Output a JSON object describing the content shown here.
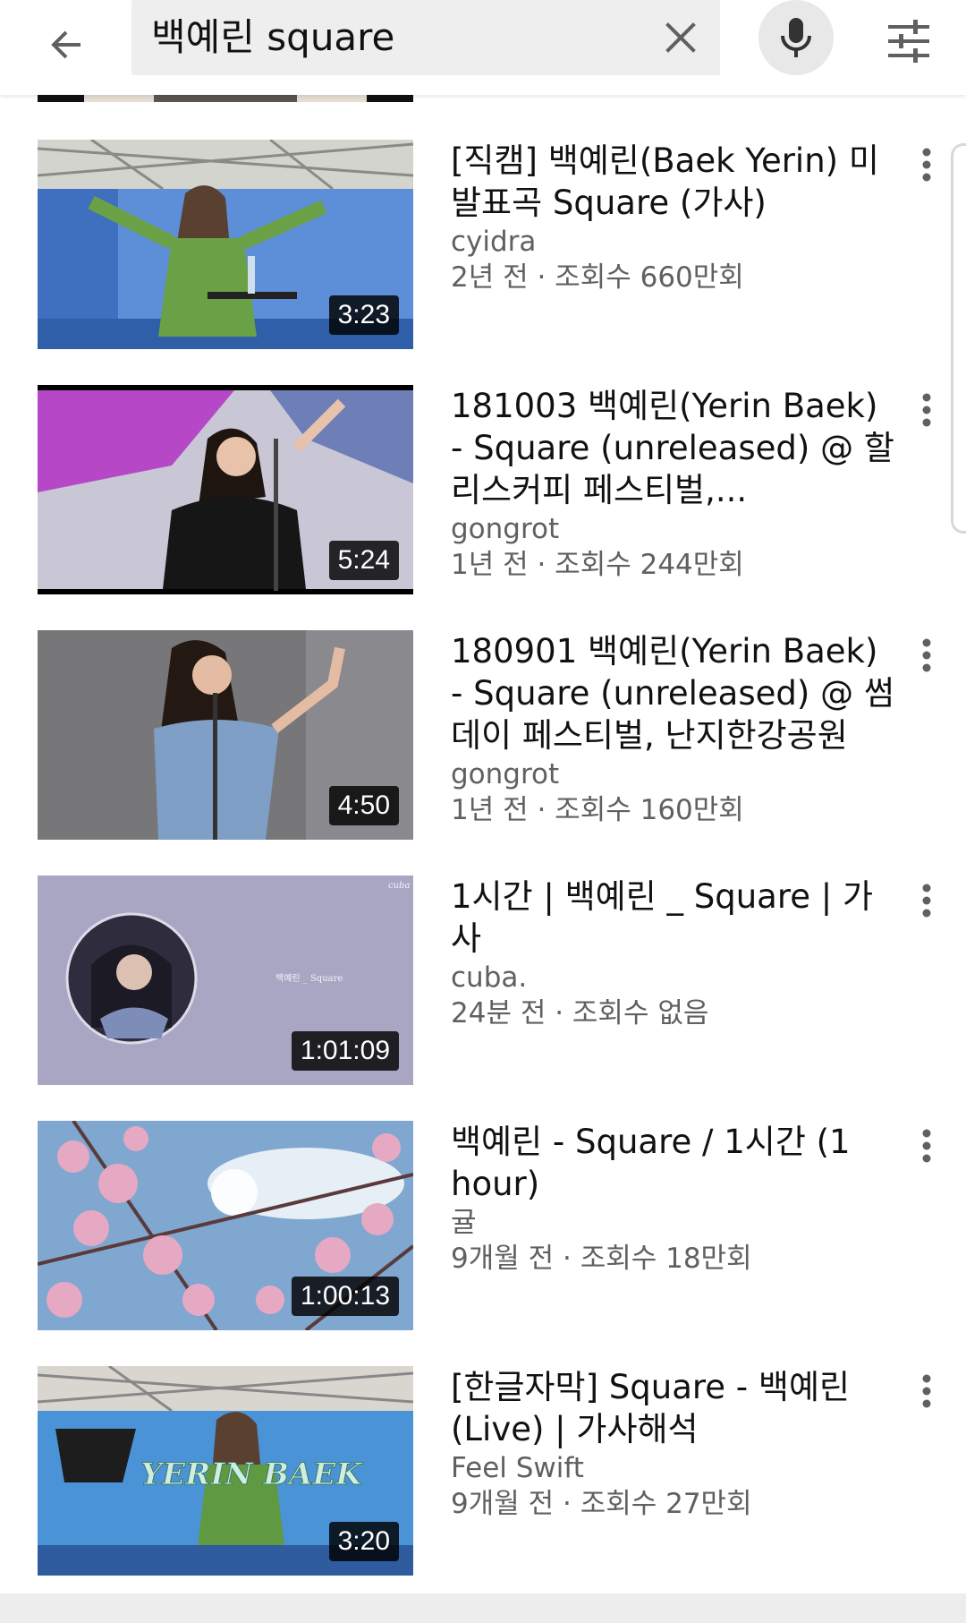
{
  "search": {
    "query": "백예린 square"
  },
  "icons": {
    "back": "arrow-back-icon",
    "clear": "close-icon",
    "mic": "mic-icon",
    "filter": "filter-sliders-icon",
    "more": "more-vert-icon"
  },
  "results": [
    {
      "title": "[직캠] 백예린(Baek Yerin) 미발표곡 Square (가사)",
      "channel": "cyidra",
      "meta": "2년 전 · 조회수 660만회",
      "duration": "3:23"
    },
    {
      "title": "181003 백예린(Yerin Baek) - Square (unreleased) @ 할리스커피 페스티벌,...",
      "channel": "gongrot",
      "meta": "1년 전 · 조회수 244만회",
      "duration": "5:24"
    },
    {
      "title": "180901 백예린(Yerin Baek) - Square (unreleased) @ 썸데이 페스티벌, 난지한강공원",
      "channel": "gongrot",
      "meta": "1년 전 · 조회수 160만회",
      "duration": "4:50"
    },
    {
      "title": "1시간 | 백예린 _ Square | 가사",
      "channel": "cuba.",
      "meta": "24분 전 · 조회수 없음",
      "duration": "1:01:09"
    },
    {
      "title": "백예린 - Square / 1시간 (1 hour)",
      "channel": "귤",
      "meta": "9개월 전 · 조회수 18만회",
      "duration": "1:00:13"
    },
    {
      "title": "[한글자막] Square - 백예린 (Live) | 가사해석",
      "channel": "Feel Swift",
      "meta": "9개월 전 · 조회수 27만회",
      "duration": "3:20"
    }
  ],
  "thumbnail_text": {
    "r4_corner": "cuba",
    "r4_caption": "백예린 _ Square",
    "r6_logo": "YERIN BAEK"
  },
  "colors": {
    "search_bg": "#eeeeee",
    "secondary_text": "#606060",
    "primary_text": "#111111"
  }
}
